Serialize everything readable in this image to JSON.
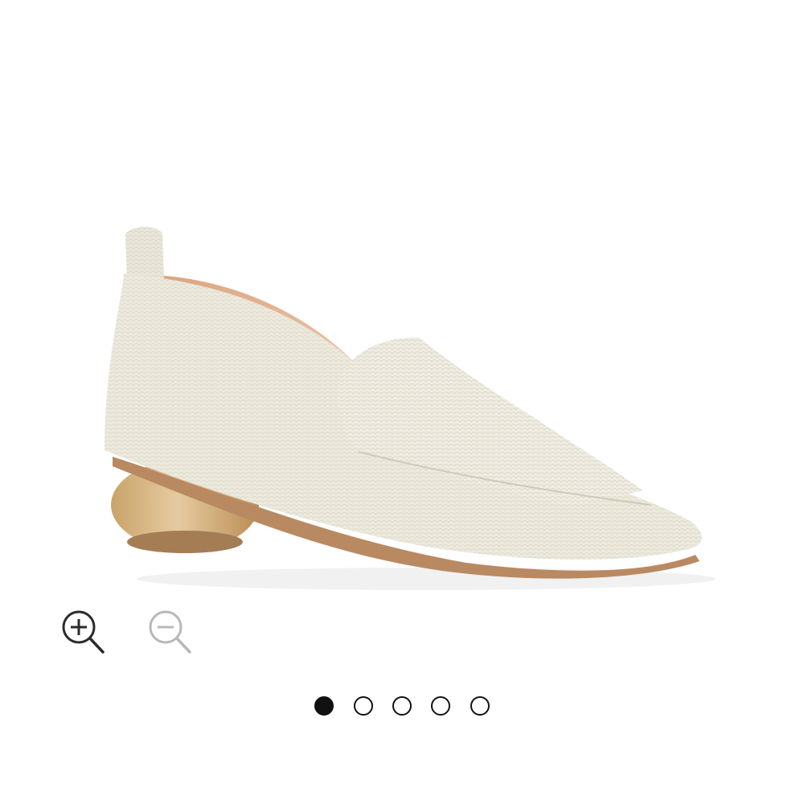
{
  "product_image": {
    "alt": "",
    "colors": {
      "upper": "#ece9dd",
      "lining": "#e2b896",
      "heel": "#d8b77e",
      "sole": "#b98a62"
    }
  },
  "zoom": {
    "in_icon": "zoom-in-icon",
    "out_icon": "zoom-out-icon",
    "out_disabled": true
  },
  "carousel": {
    "count": 5,
    "active_index": 0
  }
}
